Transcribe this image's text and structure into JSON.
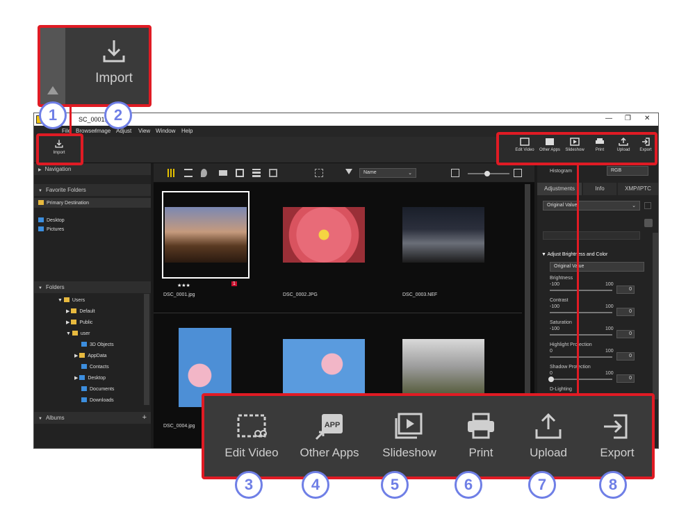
{
  "window": {
    "tab_title": "SC_0001.jpg",
    "menus": [
      "File",
      "Browser",
      "Image",
      "Adjust",
      "View",
      "Window",
      "Help"
    ]
  },
  "toolbar_right": [
    {
      "label": "Edit Video",
      "icon": "edit-video-icon"
    },
    {
      "label": "Other Apps",
      "icon": "app-icon"
    },
    {
      "label": "Slideshow",
      "icon": "slideshow-icon"
    },
    {
      "label": "Print",
      "icon": "print-icon"
    },
    {
      "label": "Upload",
      "icon": "upload-icon"
    },
    {
      "label": "Export",
      "icon": "export-icon"
    }
  ],
  "import": {
    "label": "Import",
    "big_label": "Import"
  },
  "left_panel": {
    "navigation": "Navigation",
    "favorite_folders": "Favorite Folders",
    "primary_destination": "Primary Destination",
    "desktop": "Desktop",
    "pictures": "Pictures",
    "folders": "Folders",
    "tree": [
      "Users",
      "Default",
      "Public",
      "user",
      "3D Objects",
      "AppData",
      "Contacts",
      "Desktop",
      "Documents",
      "Downloads"
    ],
    "albums": "Albums"
  },
  "browser": {
    "sort_label": "Name",
    "thumbnails": [
      {
        "name": "DSC_0001.jpg",
        "rating": "★★★",
        "badge": "1"
      },
      {
        "name": "DSC_0002.JPG"
      },
      {
        "name": "DSC_0003.NEF"
      },
      {
        "name": "DSC_0004.jpg"
      }
    ]
  },
  "right_panel": {
    "histogram": "Histogram",
    "histogram_mode": "RGB",
    "tabs": [
      "Adjustments",
      "Info",
      "XMP/IPTC"
    ],
    "preset": "Original Value",
    "section": "Adjust Brightness and Color",
    "section_preset": "Original Value",
    "sliders": [
      {
        "label": "Brightness",
        "min": "-100",
        "max": "100",
        "value": "0"
      },
      {
        "label": "Contrast",
        "min": "-100",
        "max": "100",
        "value": "0"
      },
      {
        "label": "Saturation",
        "min": "-100",
        "max": "100",
        "value": "0"
      },
      {
        "label": "Highlight Protection",
        "min": "0",
        "max": "100",
        "value": "0"
      },
      {
        "label": "Shadow Protection",
        "min": "0",
        "max": "100",
        "value": "0"
      }
    ],
    "d_lighting": "D-Lighting"
  },
  "callout_buttons": [
    "Edit Video",
    "Other Apps",
    "Slideshow",
    "Print",
    "Upload",
    "Export"
  ],
  "callout_numbers": [
    "1",
    "2",
    "3",
    "4",
    "5",
    "6",
    "7",
    "8"
  ],
  "colors": {
    "accent": "#e01b24",
    "number_circle": "#6f7fe6"
  }
}
